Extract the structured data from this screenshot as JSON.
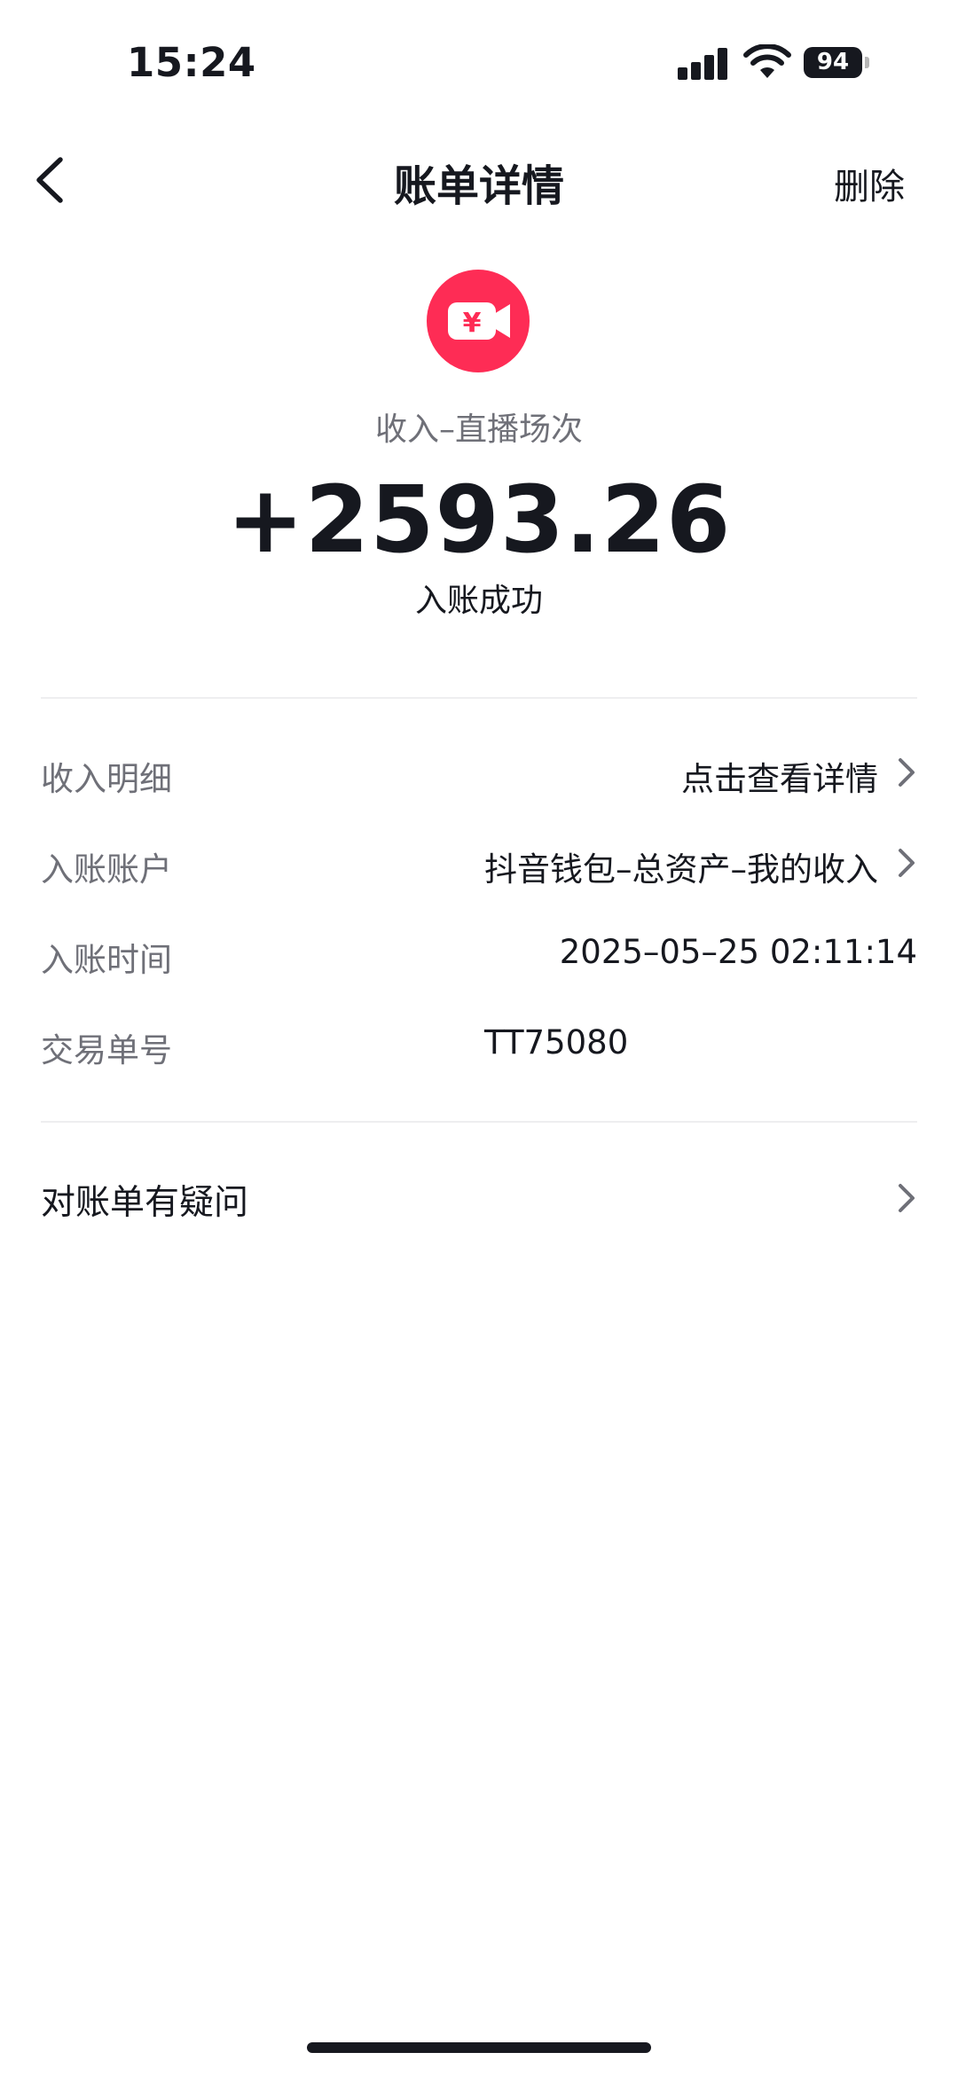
{
  "status_bar": {
    "time": "15:24",
    "battery": "94"
  },
  "nav": {
    "title": "账单详情",
    "delete_label": "删除"
  },
  "header": {
    "category": "收入–直播场次",
    "amount": "+2593.26",
    "status": "入账成功"
  },
  "details": {
    "income_detail": {
      "label": "收入明细",
      "value": "点击查看详情"
    },
    "account": {
      "label": "入账账户",
      "value": "抖音钱包–总资产–我的收入"
    },
    "time": {
      "label": "入账时间",
      "value": "2025–05–25 02:11:14"
    },
    "order": {
      "label": "交易单号",
      "value": "TT75080"
    }
  },
  "question": {
    "label": "对账单有疑问"
  },
  "colors": {
    "accent": "#fe2c55",
    "text": "#16181f",
    "muted": "#6f7078"
  }
}
